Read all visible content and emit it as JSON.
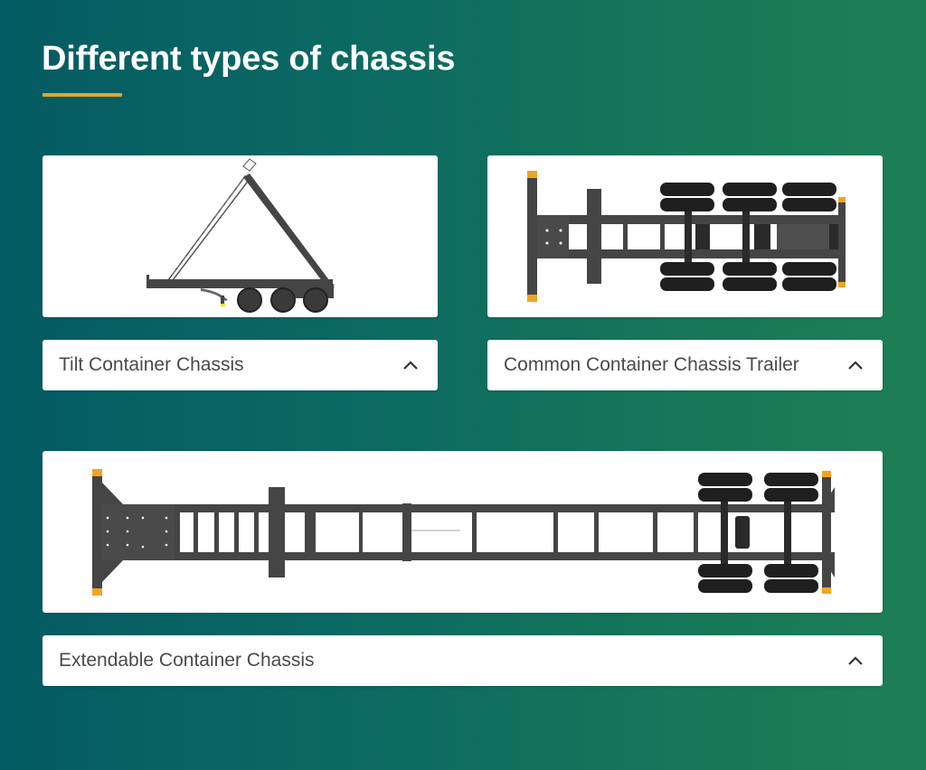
{
  "page": {
    "title": "Different types of chassis",
    "accent_color": "#e9a426",
    "gradient_colors": [
      "#045b63",
      "#1e7f56"
    ]
  },
  "items": [
    {
      "label": "Tilt Container Chassis",
      "image": "tilt-container-chassis-illustration",
      "toggle_icon": "chevron-up-icon",
      "expanded": true
    },
    {
      "label": "Common Container Chassis Trailer",
      "image": "common-container-chassis-trailer-illustration",
      "toggle_icon": "chevron-up-icon",
      "expanded": true
    },
    {
      "label": "Extendable Container Chassis",
      "image": "extendable-container-chassis-illustration",
      "toggle_icon": "chevron-up-icon",
      "expanded": true
    }
  ]
}
